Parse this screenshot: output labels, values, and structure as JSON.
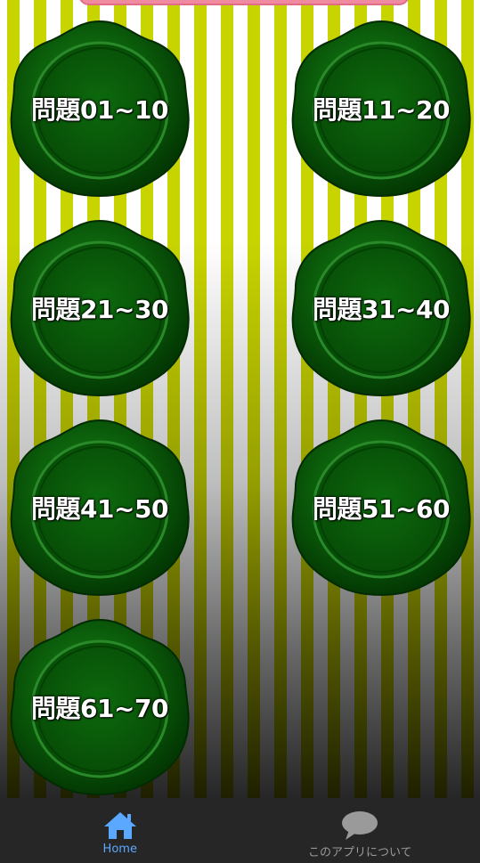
{
  "buttons": [
    {
      "label": "問題01~10"
    },
    {
      "label": "問題11~20"
    },
    {
      "label": "問題21~30"
    },
    {
      "label": "問題31~40"
    },
    {
      "label": "問題41~50"
    },
    {
      "label": "問題51~60"
    },
    {
      "label": "問題61~70"
    }
  ],
  "tabbar": {
    "home": {
      "label": "Home",
      "icon": "home-icon"
    },
    "about": {
      "label": "このアプリについて",
      "icon": "speech-bubble-icon"
    }
  },
  "colors": {
    "stripe_yellow": "#c8d400",
    "seal_green": "#0b5e0b",
    "active_tab": "#5aa8ff",
    "inactive_tab": "#9a9a9a",
    "tabbar_bg": "#262626"
  }
}
